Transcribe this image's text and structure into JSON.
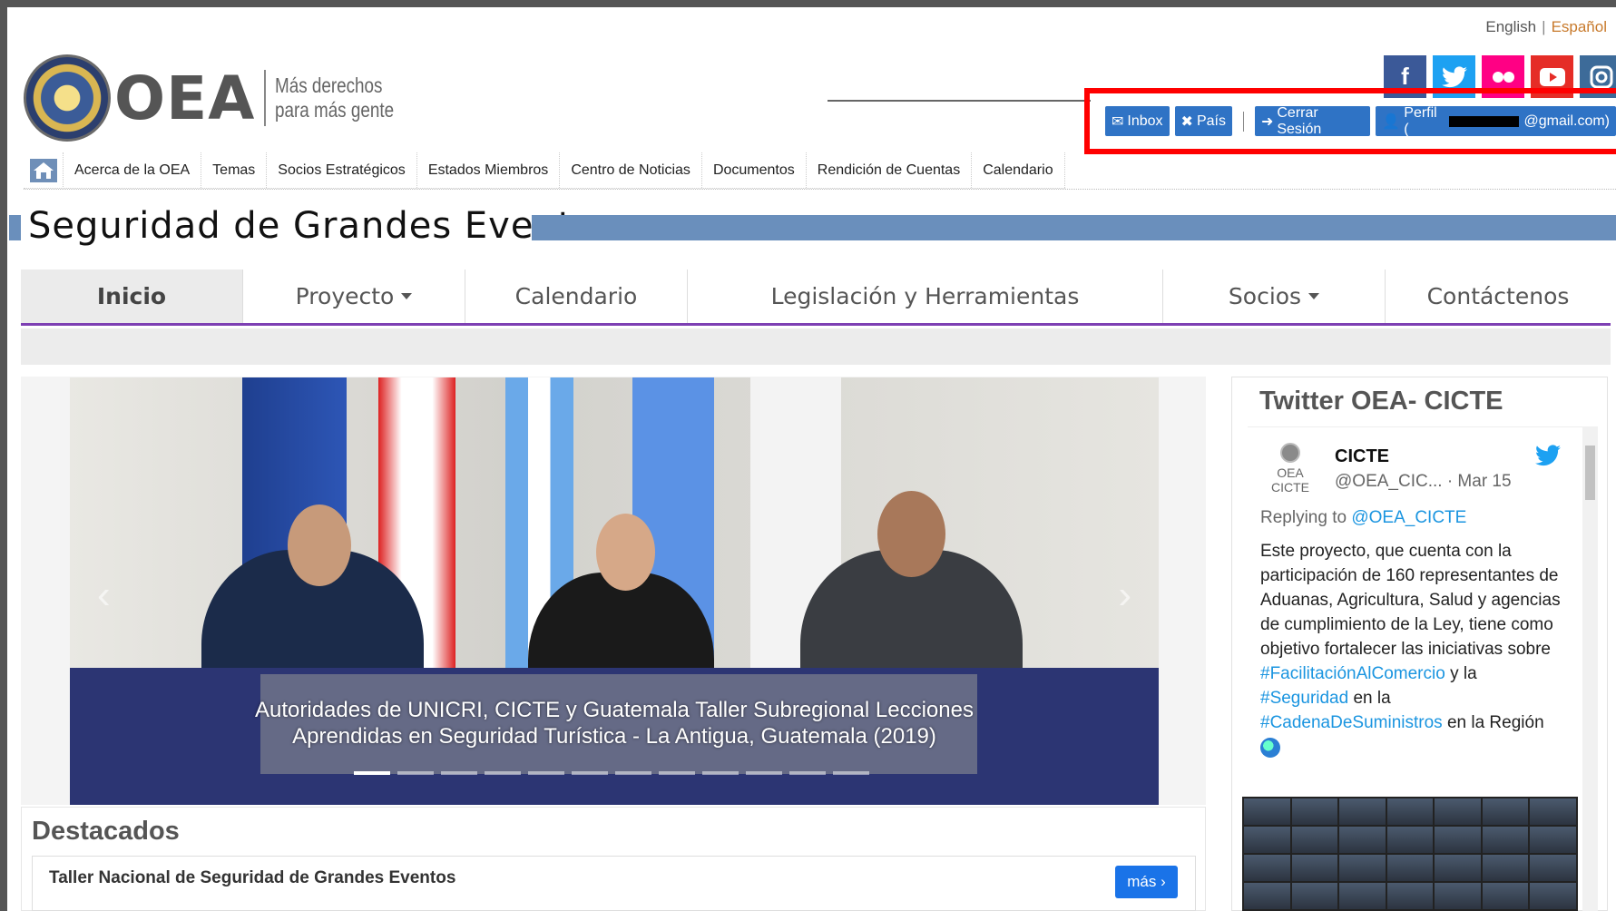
{
  "lang": {
    "english": "English",
    "espanol": "Español"
  },
  "logo": {
    "acronym": "OEA",
    "tagline_1": "Más derechos",
    "tagline_2": "para más gente"
  },
  "userbar": {
    "inbox": "Inbox",
    "pais": "País",
    "logout": "Cerrar Sesión",
    "perfil_prefix": "Perfil (",
    "perfil_suffix": "@gmail.com)"
  },
  "topnav": [
    "Acerca de la OEA",
    "Temas",
    "Socios Estratégicos",
    "Estados Miembros",
    "Centro de Noticias",
    "Documentos",
    "Rendición de Cuentas",
    "Calendario"
  ],
  "page_title": "Seguridad de Grandes Eventos",
  "tabs": [
    "Inicio",
    "Proyecto",
    "Calendario",
    "Legislación y Herramientas",
    "Socios",
    "Contáctenos"
  ],
  "carousel": {
    "caption_1": "Autoridades de UNICRI, CICTE y Guatemala Taller Subregional Lecciones",
    "caption_2": "Aprendidas en Seguridad Turística - La Antigua, Guatemala (2019)",
    "slide_count": 12,
    "active_slide": 1
  },
  "destacados": {
    "title": "Destacados",
    "item": "Taller Nacional de Seguridad de Grandes Eventos",
    "more": "más"
  },
  "twitter": {
    "title": "Twitter OEA- CICTE",
    "avatar_1": "OEA",
    "avatar_2": "CICTE",
    "name": "CICTE",
    "handle": "@OEA_CIC... · Mar 15",
    "replying_prefix": "Replying to ",
    "replying_handle": "@OEA_CICTE",
    "body_1": "Este proyecto, que cuenta con la participación de 160 representantes de Aduanas, Agricultura, Salud y agencias de cumplimiento de la Ley, tiene como objetivo fortalecer las iniciativas sobre",
    "hash_1": "#FacilitaciónAlComercio",
    "and": " y la",
    "hash_2": "#Seguridad",
    "in": " en la",
    "hash_3": "#CadenaDeSuministros",
    "region": " en la Región"
  },
  "colors": {
    "accent_blue": "#2f73c5",
    "title_bar": "#6a8fbc",
    "tab_underline": "#7d3fb3",
    "highlight_box": "#ff0000",
    "twitter_blue": "#1da1f2"
  }
}
